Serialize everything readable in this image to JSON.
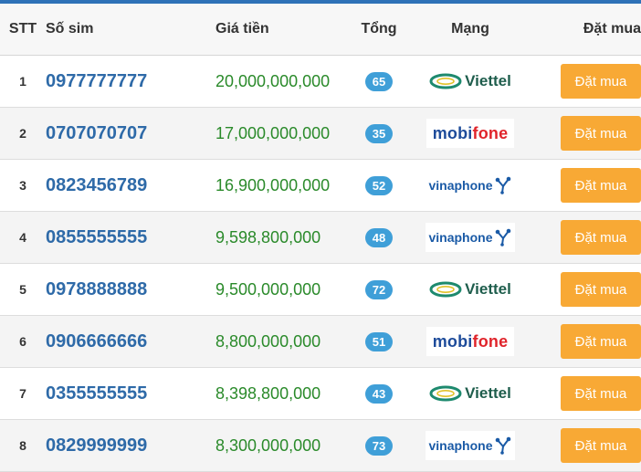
{
  "colors": {
    "top_bar": "#2e72b8",
    "sim_number": "#2e6aa8",
    "price": "#2a8a2a",
    "badge": "#3f9fd8",
    "buy_button": "#f8a935",
    "row_alt": "#f4f4f4"
  },
  "table": {
    "headers": {
      "stt": "STT",
      "sim": "Số sim",
      "price": "Giá tiền",
      "total": "Tổng",
      "network": "Mạng",
      "buy": "Đặt mua"
    },
    "rows": [
      {
        "stt": "1",
        "sim": "0977777777",
        "price": "20,000,000,000",
        "total": "65",
        "network": "Viettel",
        "logo": "viettel-logo-icon",
        "buy": "Đặt mua"
      },
      {
        "stt": "2",
        "sim": "0707070707",
        "price": "17,000,000,000",
        "total": "35",
        "network": "mobifone",
        "logo": "mobifone-logo-icon",
        "buy": "Đặt mua"
      },
      {
        "stt": "3",
        "sim": "0823456789",
        "price": "16,900,000,000",
        "total": "52",
        "network": "vinaphone",
        "logo": "vinaphone-logo-icon",
        "buy": "Đặt mua"
      },
      {
        "stt": "4",
        "sim": "0855555555",
        "price": "9,598,800,000",
        "total": "48",
        "network": "vinaphone",
        "logo": "vinaphone-logo-icon",
        "buy": "Đặt mua"
      },
      {
        "stt": "5",
        "sim": "0978888888",
        "price": "9,500,000,000",
        "total": "72",
        "network": "Viettel",
        "logo": "viettel-logo-icon",
        "buy": "Đặt mua"
      },
      {
        "stt": "6",
        "sim": "0906666666",
        "price": "8,800,000,000",
        "total": "51",
        "network": "mobifone",
        "logo": "mobifone-logo-icon",
        "buy": "Đặt mua"
      },
      {
        "stt": "7",
        "sim": "0355555555",
        "price": "8,398,800,000",
        "total": "43",
        "network": "Viettel",
        "logo": "viettel-logo-icon",
        "buy": "Đặt mua"
      },
      {
        "stt": "8",
        "sim": "0829999999",
        "price": "8,300,000,000",
        "total": "73",
        "network": "vinaphone",
        "logo": "vinaphone-logo-icon",
        "buy": "Đặt mua"
      }
    ]
  }
}
